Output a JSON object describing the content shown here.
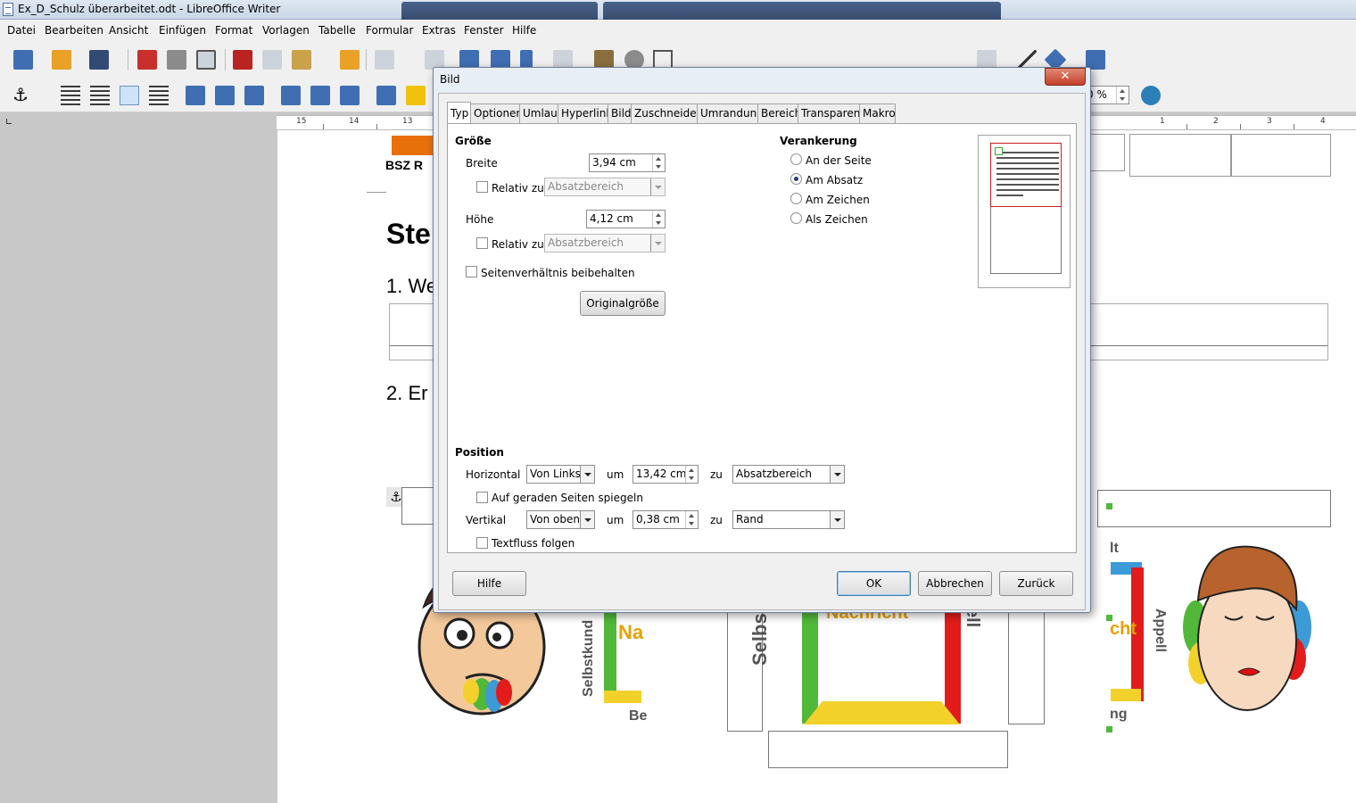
{
  "window": {
    "title": "Ex_D_Schulz überarbeitet.odt - LibreOffice Writer"
  },
  "menu": [
    "Datei",
    "Bearbeiten",
    "Ansicht",
    "Einfügen",
    "Format",
    "Vorlagen",
    "Tabelle",
    "Formular",
    "Extras",
    "Fenster",
    "Hilfe"
  ],
  "ruler": {
    "left_ticks": [
      "15",
      "14",
      "13"
    ],
    "right_ticks": [
      "1",
      "2",
      "3",
      "4"
    ]
  },
  "toolbar2": {
    "zoom_partial": "0 %"
  },
  "document": {
    "header_logo": "BSZ R",
    "heading": "Ste",
    "item1": "1. We",
    "item2": "2. Er",
    "labels": {
      "selbstkunde_left": "Selbstkund",
      "na": "Na",
      "be": "Be",
      "selbstk_center": "Selbstk",
      "nachricht": "Nachricht",
      "ell": "ell",
      "lt": "lt",
      "cht": "cht",
      "appell": "Appell",
      "ng": "ng"
    }
  },
  "dialog": {
    "title": "Bild",
    "close": "✕",
    "tabs": [
      "Typ",
      "Optionen",
      "Umlauf",
      "Hyperlink",
      "Bild",
      "Zuschneiden",
      "Umrandung",
      "Bereich",
      "Transparenz",
      "Makro"
    ],
    "size": {
      "section": "Größe",
      "width_label": "Breite",
      "width_value": "3,94 cm",
      "relative_label": "Relativ zu",
      "relative_value": "Absatzbereich",
      "height_label": "Höhe",
      "height_value": "4,12 cm",
      "keep_ratio": "Seitenverhältnis beibehalten",
      "original_size": "Originalgröße"
    },
    "anchor": {
      "section": "Verankerung",
      "options": [
        "An der Seite",
        "Am Absatz",
        "Am Zeichen",
        "Als Zeichen"
      ],
      "selected": "Am Absatz"
    },
    "position": {
      "section": "Position",
      "horizontal_label": "Horizontal",
      "horizontal_mode": "Von Links",
      "by_label": "um",
      "horizontal_value": "13,42 cm",
      "to_label": "zu",
      "horizontal_ref": "Absatzbereich",
      "mirror": "Auf geraden Seiten spiegeln",
      "vertical_label": "Vertikal",
      "vertical_mode": "Von oben",
      "vertical_value": "0,38 cm",
      "vertical_ref": "Rand",
      "follow_text": "Textfluss folgen"
    },
    "buttons": {
      "help": "Hilfe",
      "ok": "OK",
      "cancel": "Abbrechen",
      "reset": "Zurück"
    }
  }
}
